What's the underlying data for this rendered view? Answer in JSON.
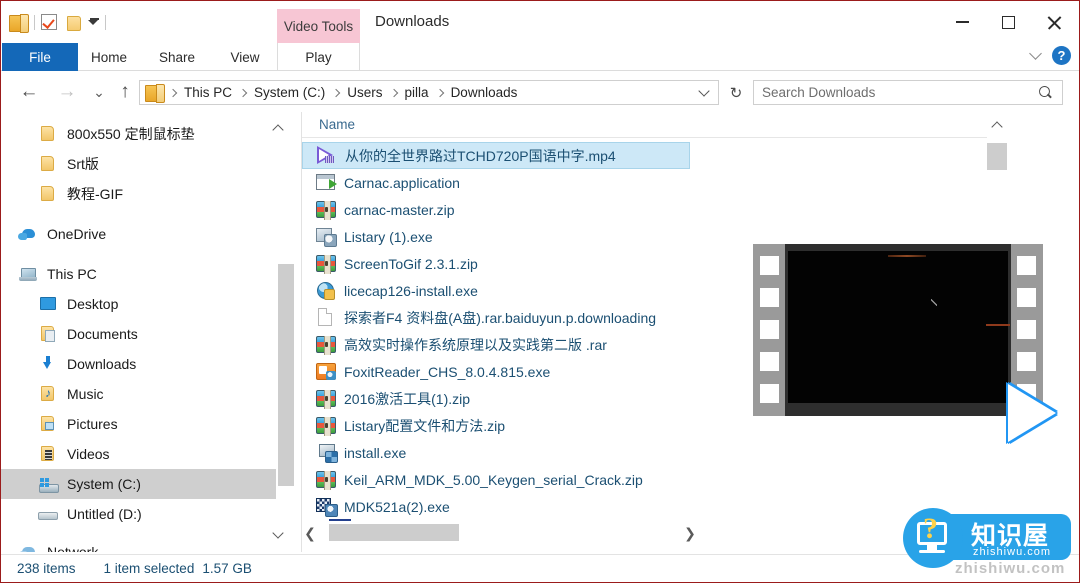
{
  "window": {
    "title": "Downloads",
    "contextual_tab": "Video Tools",
    "minimize_label": "Minimize",
    "maximize_label": "Maximize",
    "close_label": "Close"
  },
  "quick_access": [
    {
      "name": "folder-app-icon",
      "label": "File Explorer"
    },
    {
      "name": "properties-icon",
      "label": "Properties"
    },
    {
      "name": "new-folder-icon",
      "label": "New folder"
    },
    {
      "name": "customize-caret-icon",
      "label": "Customize Quick Access Toolbar"
    }
  ],
  "ribbon": {
    "tabs": [
      {
        "label": "File",
        "active": true
      },
      {
        "label": "Home",
        "active": false
      },
      {
        "label": "Share",
        "active": false
      },
      {
        "label": "View",
        "active": false
      },
      {
        "label": "Play",
        "active": false
      }
    ],
    "help_label": "?",
    "collapse_label": "Minimize the Ribbon"
  },
  "address": {
    "back_label": "←",
    "forward_label": "→",
    "recent_label": "⌄",
    "up_label": "↑",
    "breadcrumbs": [
      "This PC",
      "System (C:)",
      "Users",
      "pilla",
      "Downloads"
    ],
    "refresh_label": "↻"
  },
  "search": {
    "placeholder": "Search Downloads",
    "value": ""
  },
  "nav_pane": {
    "items": [
      {
        "label": "800x550 定制鼠标垫",
        "icon": "folder-icon",
        "indent": 36,
        "selected": false
      },
      {
        "label": "Srt版",
        "icon": "folder-icon",
        "indent": 36,
        "selected": false
      },
      {
        "label": "教程-GIF",
        "icon": "folder-icon",
        "indent": 36,
        "selected": false
      },
      {
        "label": "OneDrive",
        "icon": "onedrive-icon",
        "indent": 16,
        "selected": false
      },
      {
        "label": "This PC",
        "icon": "this-pc-icon",
        "indent": 16,
        "selected": false
      },
      {
        "label": "Desktop",
        "icon": "desktop-icon",
        "indent": 36,
        "selected": false
      },
      {
        "label": "Documents",
        "icon": "documents-icon",
        "indent": 36,
        "selected": false
      },
      {
        "label": "Downloads",
        "icon": "downloads-icon",
        "indent": 36,
        "selected": false
      },
      {
        "label": "Music",
        "icon": "music-icon",
        "indent": 36,
        "selected": false
      },
      {
        "label": "Pictures",
        "icon": "pictures-icon",
        "indent": 36,
        "selected": false
      },
      {
        "label": "Videos",
        "icon": "videos-icon",
        "indent": 36,
        "selected": false
      },
      {
        "label": "System (C:)",
        "icon": "drive-c-icon",
        "indent": 36,
        "selected": true
      },
      {
        "label": "Untitled (D:)",
        "icon": "drive-d-icon",
        "indent": 36,
        "selected": false
      },
      {
        "label": "Network",
        "icon": "network-icon",
        "indent": 16,
        "selected": false
      }
    ]
  },
  "file_list": {
    "column_header": "Name",
    "rows": [
      {
        "name": "从你的全世界路过TCHD720P国语中字.mp4",
        "icon": "video-mp4-icon",
        "selected": true
      },
      {
        "name": "Carnac.application",
        "icon": "application-icon",
        "selected": false
      },
      {
        "name": "carnac-master.zip",
        "icon": "archive-zip-icon",
        "selected": false
      },
      {
        "name": "Listary (1).exe",
        "icon": "executable-icon",
        "selected": false
      },
      {
        "name": "ScreenToGif 2.3.1.zip",
        "icon": "archive-zip-icon",
        "selected": false
      },
      {
        "name": "licecap126-install.exe",
        "icon": "globe-installer-icon",
        "selected": false
      },
      {
        "name": "探索者F4 资料盘(A盘).rar.baiduyun.p.downloading",
        "icon": "blank-document-icon",
        "selected": false
      },
      {
        "name": "高效实时操作系统原理以及实践第二版 .rar",
        "icon": "archive-zip-icon",
        "selected": false
      },
      {
        "name": "FoxitReader_CHS_8.0.4.815.exe",
        "icon": "foxit-icon",
        "selected": false
      },
      {
        "name": "2016激活工具(1).zip",
        "icon": "archive-zip-icon",
        "selected": false
      },
      {
        "name": "Listary配置文件和方法.zip",
        "icon": "archive-zip-icon",
        "selected": false
      },
      {
        "name": "install.exe",
        "icon": "install-icon",
        "selected": false
      },
      {
        "name": "Keil_ARM_MDK_5.00_Keygen_serial_Crack.zip",
        "icon": "archive-zip-icon",
        "selected": false
      },
      {
        "name": "MDK521a(2).exe",
        "icon": "mdk-icon",
        "selected": false
      }
    ]
  },
  "status_bar": {
    "item_count": "238 items",
    "selection_count": "1 item selected",
    "selection_size": "1.57 GB"
  },
  "preview": {
    "name": "video-thumbnail-preview",
    "play_label": "Play"
  },
  "watermark": {
    "brand_cn": "知识屋",
    "url": "zhishiwu.com",
    "ghost": "zhishiwu.com",
    "question_mark": "?"
  },
  "colors": {
    "file_tab_blue": "#1468b8",
    "contextual_pink": "#f7c6d4",
    "selection_blue": "#cde8f7",
    "selection_border": "#a8d4ea",
    "list_text": "#1b4f72",
    "nav_selected_gray": "#cfcfcf",
    "watermark_blue": "#29a3e8",
    "play_triangle_blue": "#2196f3"
  }
}
